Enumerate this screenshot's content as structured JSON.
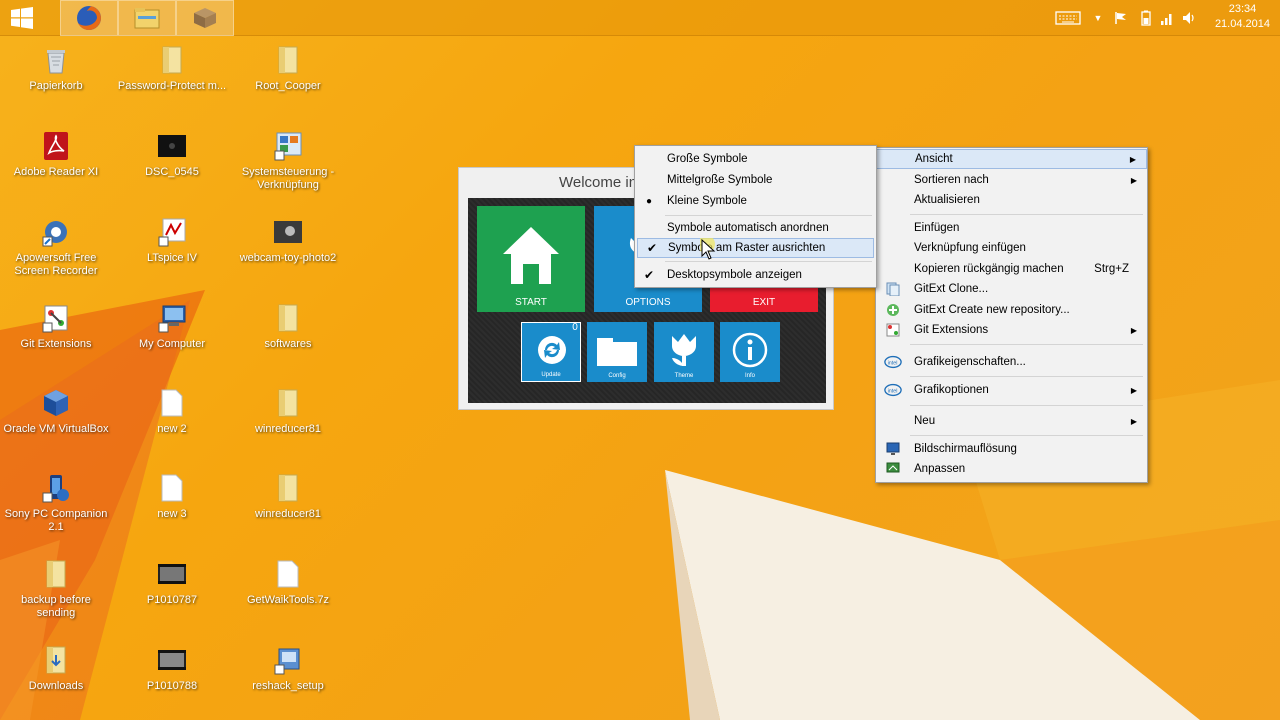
{
  "taskbar": {
    "clock_time": "23:34",
    "clock_date": "21.04.2014",
    "pinned": [
      "firefox-icon",
      "explorer-icon",
      "package-icon"
    ]
  },
  "desktop_icons": [
    {
      "label": "Papierkorb",
      "icon": "recycle-bin-icon"
    },
    {
      "label": "Password-Protect m...",
      "icon": "folder-icon"
    },
    {
      "label": "Root_Cooper",
      "icon": "folder-icon"
    },
    {
      "label": "Adobe Reader XI",
      "icon": "pdf-icon"
    },
    {
      "label": "DSC_0545",
      "icon": "image-icon"
    },
    {
      "label": "Systemsteuerung - Verknüpfung",
      "icon": "control-panel-icon"
    },
    {
      "label": "Apowersoft Free Screen Recorder",
      "icon": "recorder-icon"
    },
    {
      "label": "LTspice IV",
      "icon": "ltspice-icon"
    },
    {
      "label": "webcam-toy-photo2",
      "icon": "image-icon"
    },
    {
      "label": "Git Extensions",
      "icon": "git-icon"
    },
    {
      "label": "My Computer",
      "icon": "computer-icon"
    },
    {
      "label": "softwares",
      "icon": "folder-icon"
    },
    {
      "label": "Oracle VM VirtualBox",
      "icon": "virtualbox-icon"
    },
    {
      "label": "new 2",
      "icon": "file-icon"
    },
    {
      "label": "winreducer81",
      "icon": "folder-icon"
    },
    {
      "label": "Sony PC Companion 2.1",
      "icon": "sony-icon"
    },
    {
      "label": "new 3",
      "icon": "file-icon"
    },
    {
      "label": "winreducer81",
      "icon": "folder-icon"
    },
    {
      "label": "backup before sending",
      "icon": "folder-icon"
    },
    {
      "label": "P1010787",
      "icon": "video-icon"
    },
    {
      "label": "GetWaikTools.7z",
      "icon": "file-icon"
    },
    {
      "label": "Downloads",
      "icon": "folder-icon"
    },
    {
      "label": "P1010788",
      "icon": "video-icon"
    },
    {
      "label": "reshack_setup",
      "icon": "setup-icon"
    }
  ],
  "app": {
    "title": "Welcome in",
    "tiles": {
      "start": "START",
      "options": "OPTIONS",
      "exit": "EXIT"
    },
    "small_tiles": {
      "update": "Update",
      "config": "Config",
      "theme": "Theme",
      "info": "Info"
    },
    "badge": "0",
    "colors": {
      "start": "#1ea150",
      "options": "#1a8ccb",
      "exit": "#e81d2e"
    }
  },
  "submenu": {
    "items": [
      {
        "label": "Große Symbole"
      },
      {
        "label": "Mittelgroße Symbole"
      },
      {
        "label": "Kleine Symbole"
      },
      {
        "label": "Symbole automatisch anordnen"
      },
      {
        "label": "Symbole am Raster ausrichten"
      },
      {
        "label": "Desktopsymbole anzeigen"
      }
    ]
  },
  "context_menu": {
    "items": [
      {
        "label": "Ansicht"
      },
      {
        "label": "Sortieren nach"
      },
      {
        "label": "Aktualisieren"
      },
      {
        "label": "Einfügen"
      },
      {
        "label": "Verknüpfung einfügen"
      },
      {
        "label": "Kopieren rückgängig machen",
        "shortcut": "Strg+Z"
      },
      {
        "label": "GitExt Clone..."
      },
      {
        "label": "GitExt Create new repository..."
      },
      {
        "label": "Git Extensions"
      },
      {
        "label": "Grafikeigenschaften..."
      },
      {
        "label": "Grafikoptionen"
      },
      {
        "label": "Neu"
      },
      {
        "label": "Bildschirmauflösung"
      },
      {
        "label": "Anpassen"
      }
    ]
  }
}
